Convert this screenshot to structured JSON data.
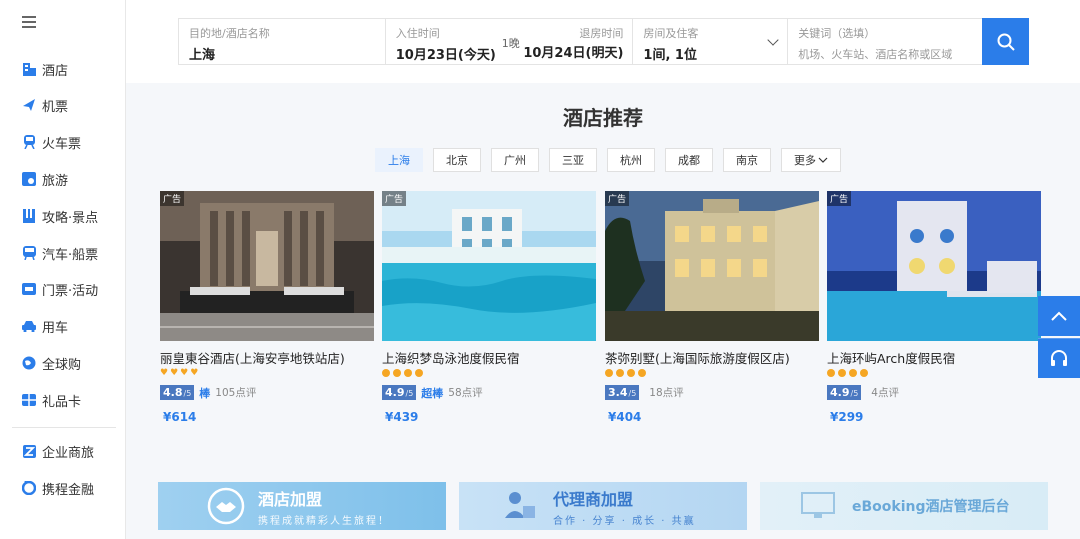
{
  "sidebar": {
    "items": [
      {
        "label": "酒店",
        "icon": "hotel-icon"
      },
      {
        "label": "机票",
        "icon": "plane-icon"
      },
      {
        "label": "火车票",
        "icon": "train-icon"
      },
      {
        "label": "旅游",
        "icon": "travel-icon"
      },
      {
        "label": "攻略·景点",
        "icon": "guide-icon"
      },
      {
        "label": "汽车·船票",
        "icon": "bus-icon"
      },
      {
        "label": "门票·活动",
        "icon": "ticket-icon"
      },
      {
        "label": "用车",
        "icon": "car-icon"
      },
      {
        "label": "全球购",
        "icon": "globe-icon"
      },
      {
        "label": "礼品卡",
        "icon": "giftcard-icon"
      }
    ],
    "bottom_items": [
      {
        "label": "企业商旅",
        "icon": "business-icon"
      },
      {
        "label": "携程金融",
        "icon": "finance-icon"
      }
    ]
  },
  "search": {
    "destination_label": "目的地/酒店名称",
    "destination_value": "上海",
    "checkin_label": "入住时间",
    "checkin_value": "10月23日(今天)",
    "nights": "1晚",
    "checkout_label": "退房时间",
    "checkout_value": "10月24日(明天)",
    "guests_label": "房间及住客",
    "guests_value": "1间, 1位",
    "keyword_label": "关键词（选填）",
    "keyword_placeholder": "机场、火车站、酒店名称或区域"
  },
  "section_title": "酒店推荐",
  "cities": [
    "上海",
    "北京",
    "广州",
    "三亚",
    "杭州",
    "成都",
    "南京"
  ],
  "more_label": "更多",
  "ad_label": "广告",
  "hotels": [
    {
      "name": "丽皇東谷酒店(上海安亭地铁站店)",
      "score": "4.8",
      "score_suffix": "/5",
      "level": "棒",
      "reviews": "105点评",
      "price": "¥614",
      "stars": 4,
      "star_type": "heart"
    },
    {
      "name": "上海织梦岛泳池度假民宿",
      "score": "4.9",
      "score_suffix": "/5",
      "level": "超棒",
      "reviews": "58点评",
      "price": "¥439",
      "stars": 4,
      "star_type": "dot"
    },
    {
      "name": "茶弥别墅(上海国际旅游度假区店)",
      "score": "3.4",
      "score_suffix": "/5",
      "level": "",
      "reviews": "18点评",
      "price": "¥404",
      "stars": 4,
      "star_type": "dot"
    },
    {
      "name": "上海环屿Arch度假民宿",
      "score": "4.9",
      "score_suffix": "/5",
      "level": "",
      "reviews": "4点评",
      "price": "¥299",
      "stars": 4,
      "star_type": "dot"
    }
  ],
  "banners": [
    {
      "title": "酒店加盟",
      "subtitle": "携程成就精彩人生旅程！"
    },
    {
      "title": "代理商加盟",
      "subtitle": "合作 · 分享 · 成长 · 共赢"
    },
    {
      "title": "eBooking酒店管理后台",
      "subtitle": ""
    }
  ],
  "colors": {
    "accent": "#2b7de9",
    "score_bg": "#4a78c0",
    "star": "#f5a623"
  }
}
